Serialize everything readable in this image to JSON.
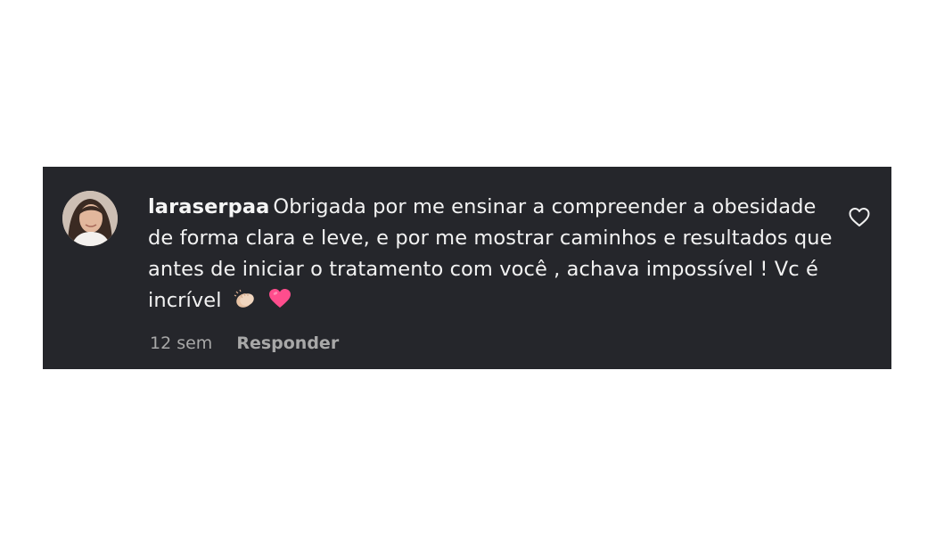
{
  "comment": {
    "username": "laraserpaa",
    "text": "Obrigada por me ensinar a compreender a obesidade de forma clara e leve, e por me mostrar caminhos e resultados que antes de iniciar o tratamento com você , achava impossível ! Vc é incrível",
    "emojis": [
      "clapping-hands",
      "pink-heart"
    ],
    "timestamp": "12 sem",
    "reply_label": "Responder"
  },
  "colors": {
    "card_background": "#25262b",
    "text": "#f2f2f2",
    "meta_text": "#a8a8a8",
    "heart_emoji": "#ff4d8d",
    "like_icon_stroke": "#f0f0f0"
  },
  "icons": {
    "like": "heart-outline-icon",
    "avatar": "profile-photo"
  }
}
